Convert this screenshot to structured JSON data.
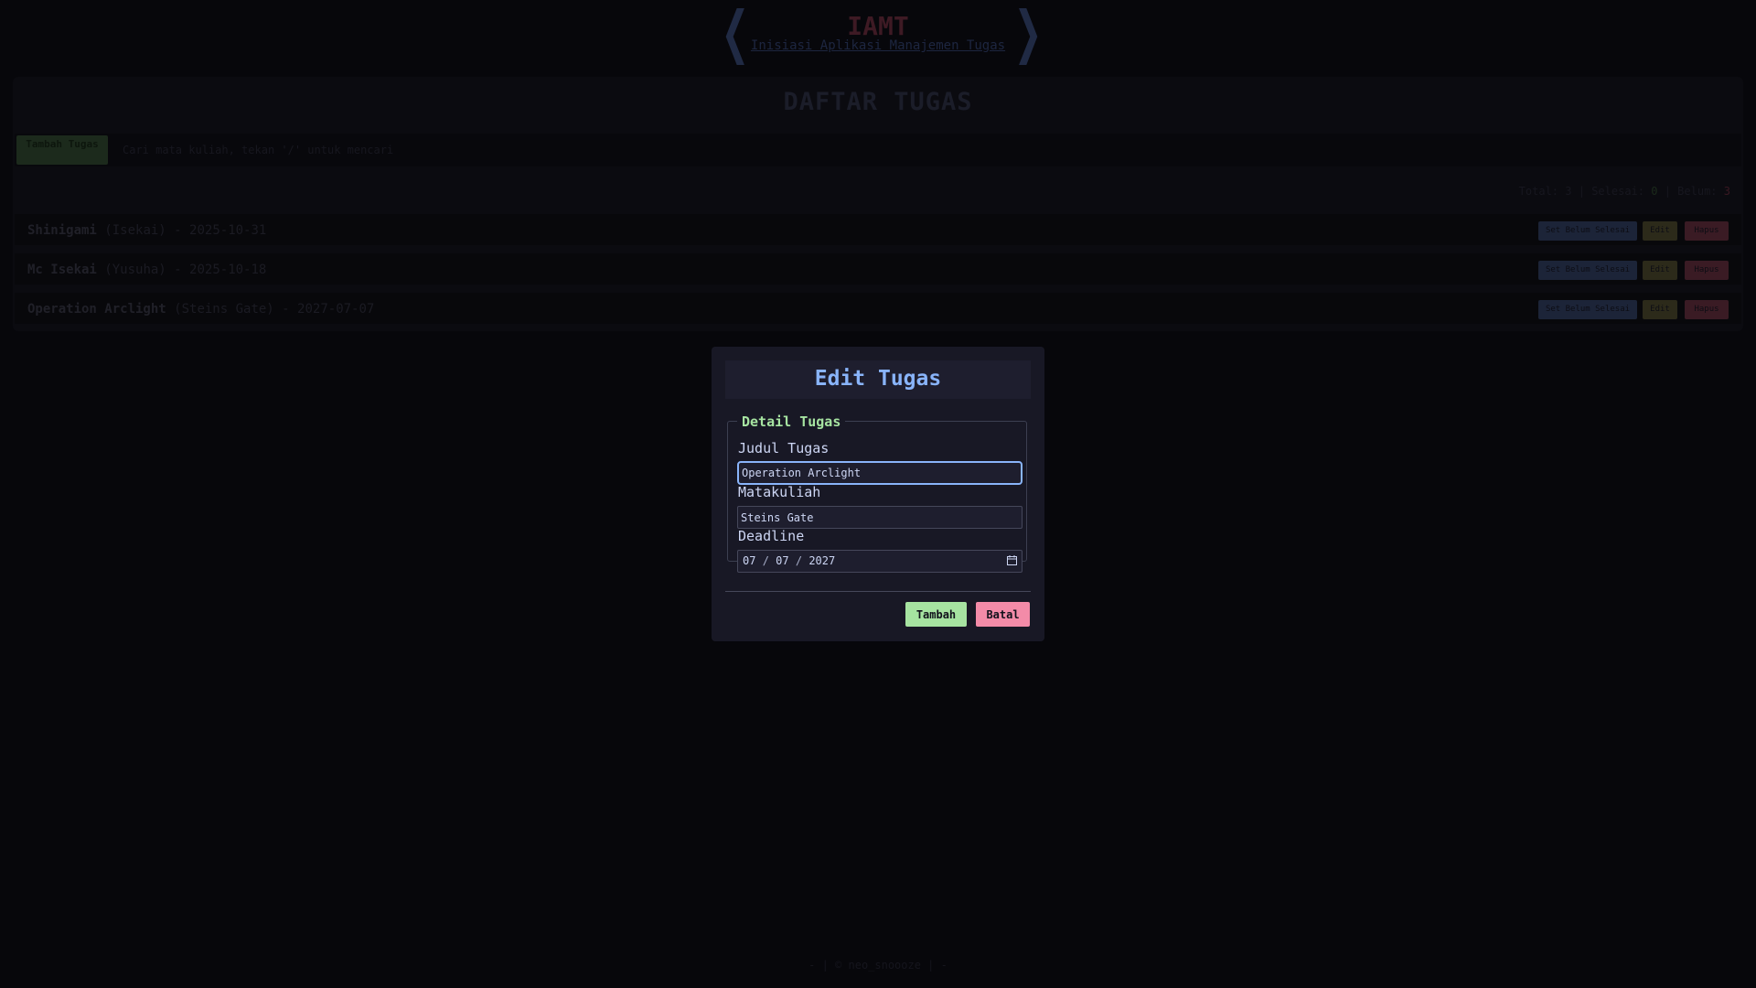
{
  "header": {
    "brand": "IAMT",
    "tagline": "Inisiasi Aplikasi Manajemen Tugas"
  },
  "main": {
    "title": "DAFTAR TUGAS",
    "add_button_label": "Tambah Tugas",
    "search_placeholder": "Cari mata kuliah, tekan '/' untuk mencari",
    "stats": {
      "total_label": "Total:",
      "total_value": "3",
      "done_label": "Selesai:",
      "done_value": "0",
      "pending_label": "Belum:",
      "pending_value": "3",
      "separator": "|"
    },
    "tasks": [
      {
        "title": "Shinigami",
        "course": "(Isekai)",
        "deadline": "2025-10-31",
        "separator": "-",
        "status_label": "Set Belum Selesai",
        "edit_label": "Edit",
        "delete_label": "Hapus"
      },
      {
        "title": "Mc Isekai",
        "course": "(Yusuha)",
        "deadline": "2025-10-18",
        "separator": "-",
        "status_label": "Set Belum Selesai",
        "edit_label": "Edit",
        "delete_label": "Hapus"
      },
      {
        "title": "Operation Arclight",
        "course": "(Steins Gate)",
        "deadline": "2027-07-07",
        "separator": "-",
        "status_label": "Set Belum Selesai",
        "edit_label": "Edit",
        "delete_label": "Hapus"
      }
    ]
  },
  "footer": {
    "text": "- | © neo_snoooze | -"
  },
  "modal": {
    "title": "Edit Tugas",
    "legend": "Detail Tugas",
    "judul_label": "Judul Tugas",
    "judul_value": "Operation Arclight",
    "matakuliah_label": "Matakuliah",
    "matakuliah_value": "Steins Gate",
    "deadline_label": "Deadline",
    "deadline_month": "07",
    "deadline_day": "07",
    "deadline_year": "2027",
    "date_separator": "/",
    "submit_label": "Tambah",
    "cancel_label": "Batal"
  },
  "icons": {
    "nav_left": "chevron-left-icon",
    "nav_right": "chevron-right-icon",
    "calendar": "calendar-icon"
  },
  "colors": {
    "background": "#07070b",
    "modal_background": "#181825",
    "accent_blue": "#89b4fa",
    "accent_green": "#a6e3a1",
    "accent_pink": "#f38ba8",
    "text": "#cdd6f4"
  }
}
